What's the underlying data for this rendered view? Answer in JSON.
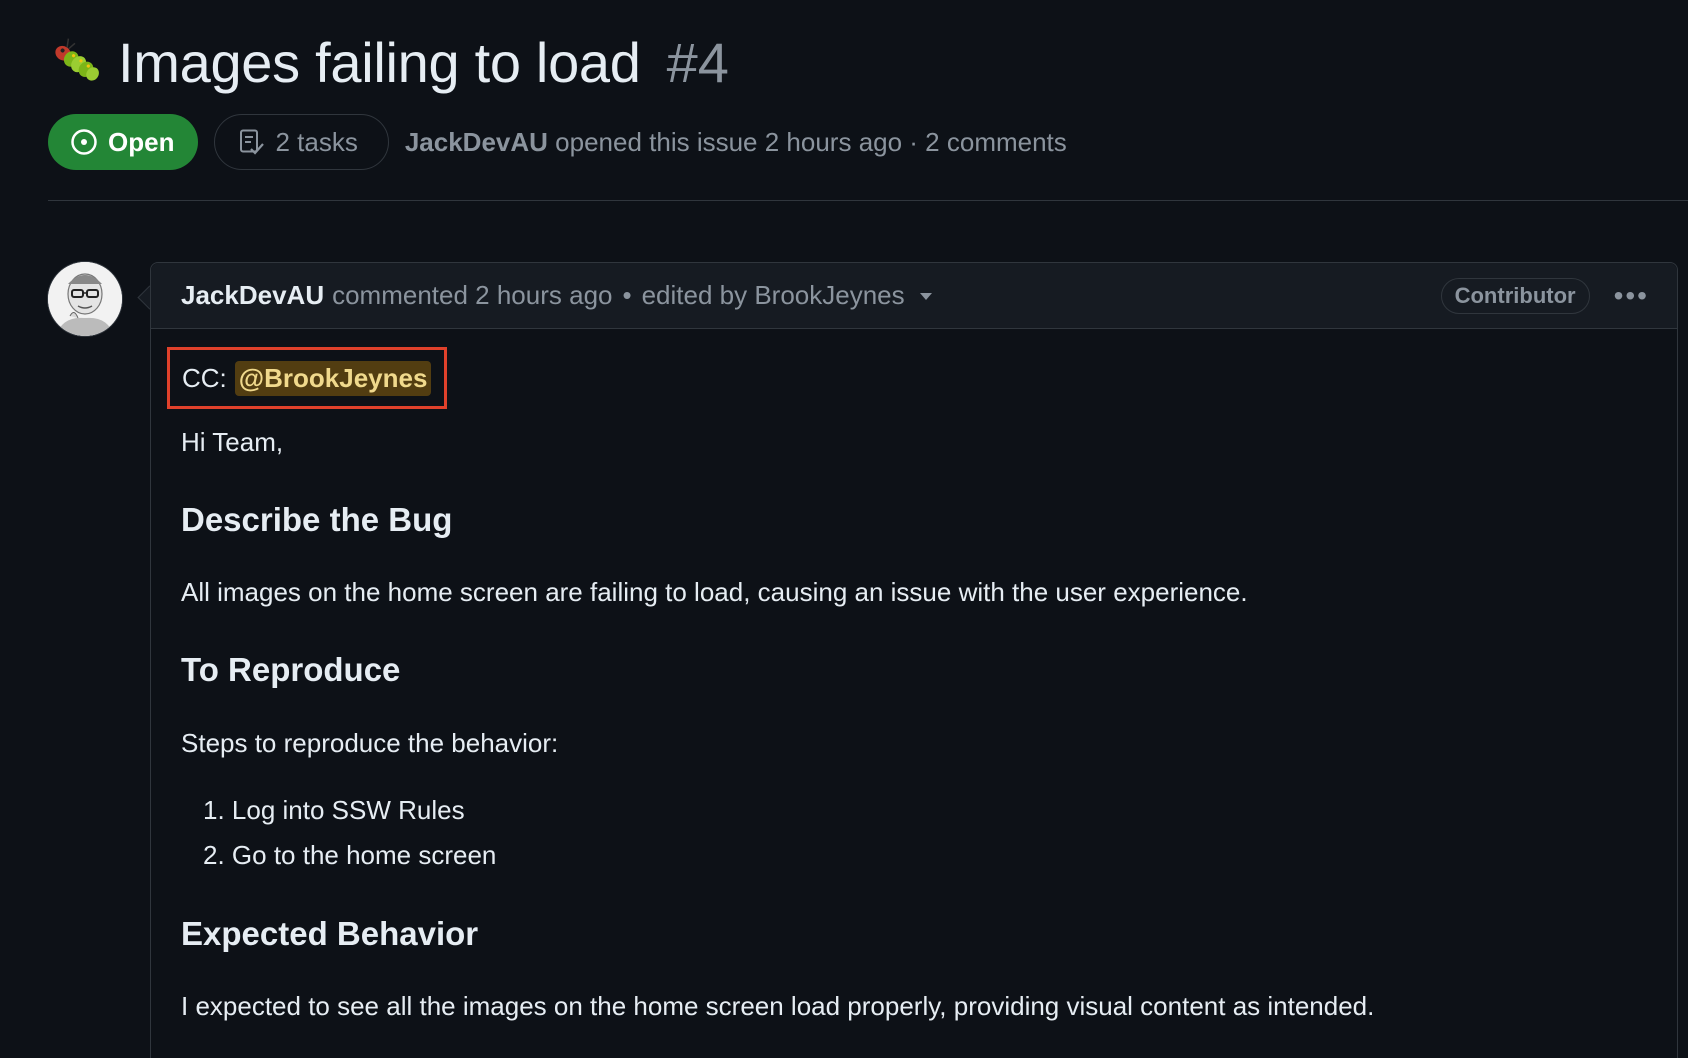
{
  "issue": {
    "title": "Images failing to load",
    "number": "#4",
    "state_label": "Open",
    "tasks_label": "2 tasks",
    "author": "JackDevAU",
    "opened_text": "opened this issue 2 hours ago · 2 comments",
    "icons": {
      "emoji": "bug-emoji-icon",
      "state": "issue-open-icon",
      "tasks": "checklist-icon"
    },
    "colors": {
      "open": "#238636",
      "background": "#0d1117",
      "highlight_box": "#e0412b"
    }
  },
  "comment": {
    "author": "JackDevAU",
    "action": "commented 2 hours ago",
    "separator": "•",
    "edited": "edited by BrookJeynes",
    "badge": "Contributor",
    "menu": "•••",
    "cc_label": "CC:",
    "mention": "@BrookJeynes",
    "greeting": "Hi Team,",
    "bug_heading": "Describe the Bug",
    "bug_text": "All images on the home screen are failing to load, causing an issue with the user experience.",
    "repro_heading": "To Reproduce",
    "repro_intro": "Steps to reproduce the behavior:",
    "steps": [
      "1. Log into SSW Rules",
      "2. Go to the home screen"
    ],
    "expected_heading": "Expected Behavior",
    "expected_text": "I expected to see all the images on the home screen load properly, providing visual content as intended."
  }
}
